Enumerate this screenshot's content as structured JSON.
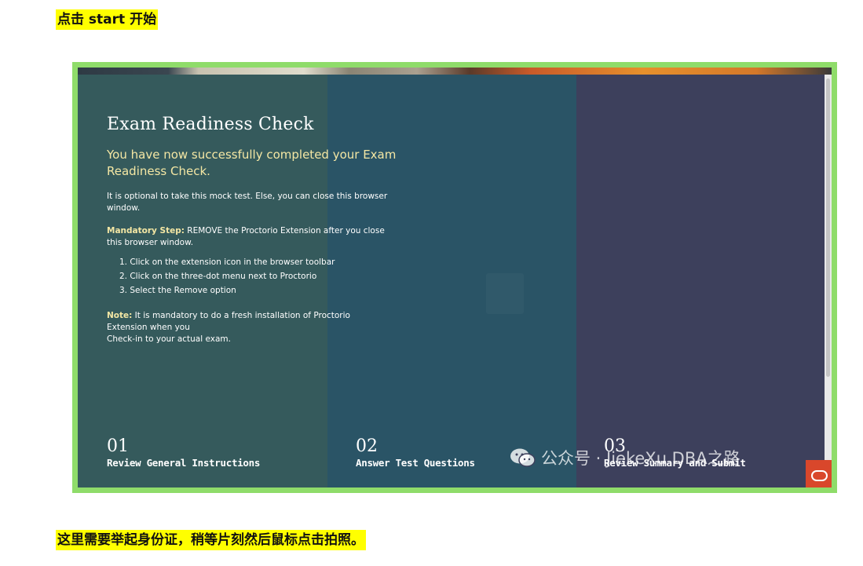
{
  "captions": {
    "top": "点击 start 开始",
    "bottom": "这里需要举起身份证，稍等片刻然后鼠标点击拍照。"
  },
  "exam": {
    "title": "Exam Readiness Check",
    "subtitle": "You have now successfully completed your Exam Readiness Check.",
    "optional_text": "It is optional to take this mock test. Else, you can close this browser window.",
    "mandatory_label": "Mandatory Step:",
    "mandatory_text": " REMOVE the Proctorio Extension after you close this browser window.",
    "steps": [
      "1. Click on the extension icon in the browser toolbar",
      "2. Click on the three-dot menu next to Proctorio",
      "3. Select the Remove option"
    ],
    "note_label": "Note:",
    "note_line1": " It is mandatory to do a fresh installation of Proctorio",
    "note_line2": "Extension when you",
    "note_line3": "Check-in to your actual exam."
  },
  "progress_steps": [
    {
      "number": "01",
      "label": "Review General Instructions"
    },
    {
      "number": "02",
      "label": "Answer Test Questions"
    },
    {
      "number": "03",
      "label": "Review Summary and Submit"
    }
  ],
  "watermark": "公众号 · JiekeXu DBA之路",
  "icons": {
    "wechat": "wechat-icon",
    "brand": "oracle-logo-icon"
  },
  "colors": {
    "frame": "#8fdc6a",
    "accent_text": "#f4e7a4",
    "caption_highlight": "#ffff00"
  }
}
